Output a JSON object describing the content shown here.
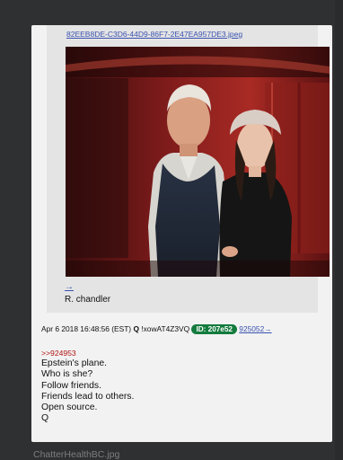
{
  "post": {
    "file_name": "82EEB8DE-C3D6-44D9-86F7-2E47EA957DE3.jpeg",
    "caption_arrow": "→",
    "caption": "R. chandler",
    "timestamp": "Apr 6 2018 16:48:56 (EST)",
    "q_mark": "Q",
    "tripcode": "!xowAT4Z3VQ",
    "id_badge": "ID: 207e52",
    "ref_link": "925052→",
    "reply_to": ">>924953",
    "lines": [
      "Epstein's plane.",
      "Who is she?",
      "Follow friends.",
      "Friends lead to others.",
      "Open source.",
      "Q"
    ]
  },
  "next_file": "ChatterHealthBC.jpg"
}
